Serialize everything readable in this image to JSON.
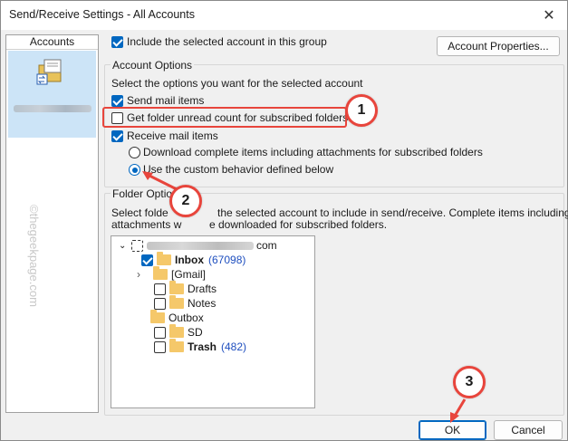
{
  "window": {
    "title": "Send/Receive Settings - All Accounts",
    "close_glyph": "✕"
  },
  "accounts_panel": {
    "header": "Accounts"
  },
  "top": {
    "include_label": "Include the selected account in this group",
    "include_checked": true,
    "account_properties_label": "Account Properties..."
  },
  "account_options": {
    "title": "Account Options",
    "instruction": "Select the options you want for the selected account",
    "send_mail_label": "Send mail items",
    "send_mail_checked": true,
    "unread_count_label": "Get folder unread count for subscribed folders",
    "unread_count_checked": false,
    "receive_mail_label": "Receive mail items",
    "receive_mail_checked": true,
    "download_complete_label": "Download complete items including attachments for subscribed folders",
    "custom_behavior_label": "Use the custom behavior defined below",
    "selected_radio": "custom"
  },
  "folder_options": {
    "title_visible": "Folder Optio",
    "line1_start": "Select folde",
    "line1_end": "the selected account to include in send/receive. Complete items including",
    "line2_start": "attachments w",
    "line2_end": "e downloaded for subscribed folders."
  },
  "tree": {
    "root_suffix": "com",
    "items": [
      {
        "name": "Inbox",
        "count": "(67098)",
        "checked": true,
        "bold": true
      },
      {
        "name": "[Gmail]",
        "expander": "›"
      },
      {
        "name": "Drafts",
        "checked": false
      },
      {
        "name": "Notes",
        "checked": false
      },
      {
        "name": "Outbox"
      },
      {
        "name": "SD",
        "checked": false
      },
      {
        "name": "Trash",
        "count": "(482)",
        "checked": false,
        "bold": true
      }
    ]
  },
  "buttons": {
    "ok_label": "OK",
    "cancel_label": "Cancel"
  },
  "watermark": "©thegeekpage.com",
  "callouts": [
    "1",
    "2",
    "3"
  ],
  "colors": {
    "accent": "#0067c0",
    "annotation_red": "#e8453c",
    "selection": "#cce4f7"
  }
}
